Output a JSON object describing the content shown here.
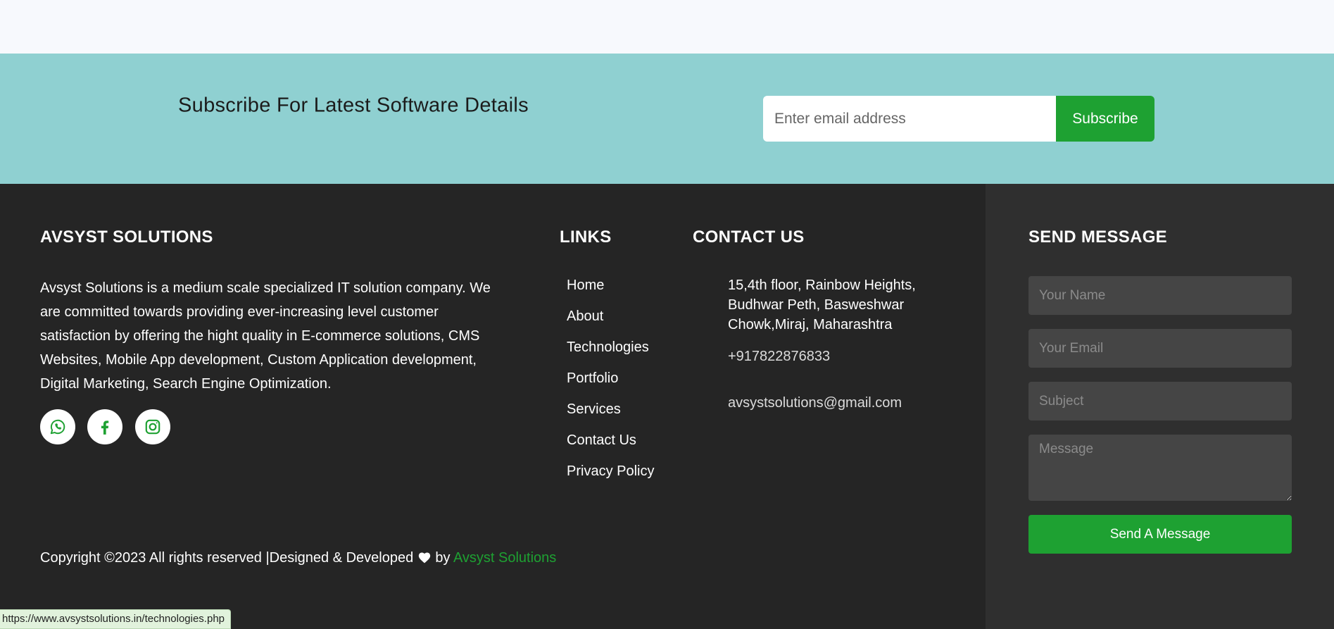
{
  "subscribe": {
    "title": "Subscribe For Latest Software Details",
    "email_placeholder": "Enter email address",
    "button_label": "Subscribe"
  },
  "footer": {
    "about": {
      "heading": "AVSYST SOLUTIONS",
      "text": "Avsyst Solutions is a medium scale specialized IT solution company. We are committed towards providing ever-increasing level customer satisfaction by offering the hight quality in E-commerce solutions, CMS Websites, Mobile App development, Custom Application development, Digital Marketing, Search Engine Optimization.",
      "social": [
        {
          "icon": "whatsapp-icon"
        },
        {
          "icon": "facebook-icon"
        },
        {
          "icon": "instagram-icon"
        }
      ]
    },
    "links": {
      "heading": "LINKS",
      "items": [
        "Home",
        "About",
        "Technologies",
        "Portfolio",
        "Services",
        "Contact Us",
        "Privacy Policy"
      ]
    },
    "contact": {
      "heading": "CONTACT US",
      "address": "15,4th floor, Rainbow Heights, Budhwar Peth, Basweshwar Chowk,Miraj, Maharashtra",
      "phone": "+917822876833",
      "email": "avsystsolutions@gmail.com"
    },
    "send_message": {
      "heading": "SEND MESSAGE",
      "name_placeholder": "Your Name",
      "email_placeholder": "Your Email",
      "subject_placeholder": "Subject",
      "message_placeholder": "Message",
      "button_label": "Send A Message"
    },
    "copyright": {
      "text": "Copyright ©2023 All rights reserved |Designed & Developed",
      "by": "by",
      "brand": "Avsyst Solutions"
    }
  },
  "status_bar": {
    "url": "https://www.avsystsolutions.in/technologies.php"
  },
  "colors": {
    "accent_green": "#1ea132",
    "subscribe_band": "#8fd0d1",
    "footer_bg": "#252525",
    "footer_right_bg": "#2f2f2f"
  }
}
